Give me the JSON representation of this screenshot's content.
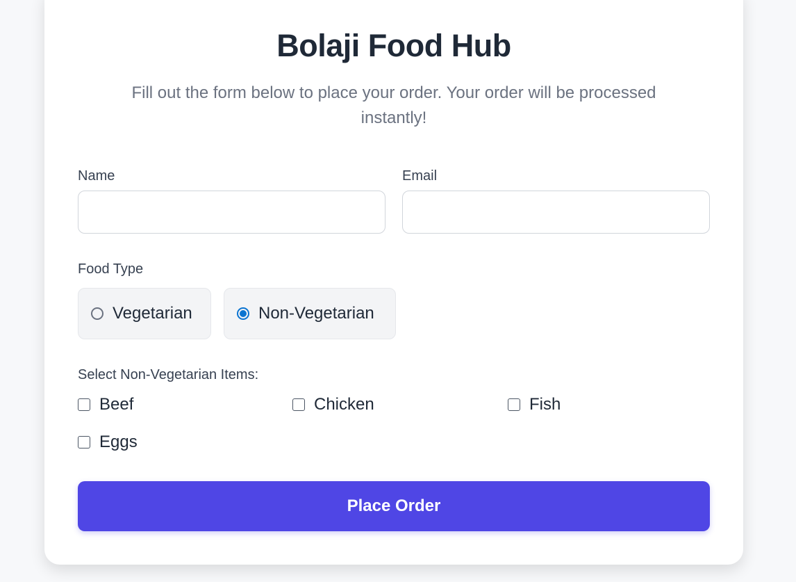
{
  "header": {
    "title": "Bolaji Food Hub",
    "subtitle": "Fill out the form below to place your order. Your order will be processed instantly!"
  },
  "form": {
    "name": {
      "label": "Name",
      "value": "",
      "placeholder": ""
    },
    "email": {
      "label": "Email",
      "value": "",
      "placeholder": ""
    },
    "food_type": {
      "label": "Food Type",
      "selected": "Non-Vegetarian",
      "options": [
        {
          "label": "Vegetarian",
          "checked": false
        },
        {
          "label": "Non-Vegetarian",
          "checked": true
        }
      ]
    },
    "items": {
      "label": "Select Non-Vegetarian Items:",
      "options": [
        {
          "label": "Beef",
          "checked": false
        },
        {
          "label": "Chicken",
          "checked": false
        },
        {
          "label": "Fish",
          "checked": false
        },
        {
          "label": "Eggs",
          "checked": false
        }
      ]
    },
    "submit_label": "Place Order"
  },
  "colors": {
    "accent": "#4f46e5",
    "radio_checked": "#0b74d1",
    "page_background": "#f7f8fa",
    "card_background": "#ffffff"
  }
}
